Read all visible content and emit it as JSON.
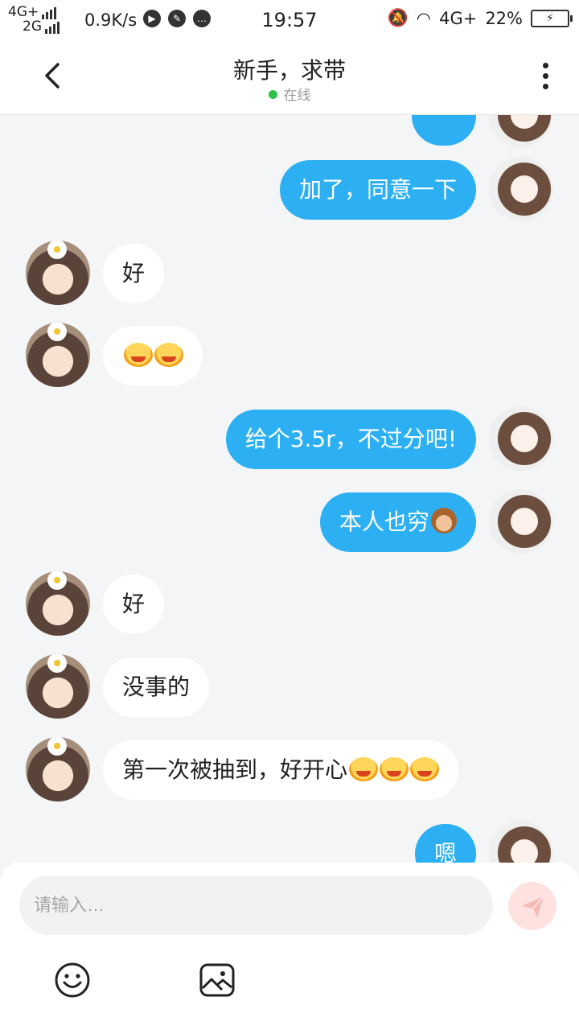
{
  "status_bar": {
    "net1": "4G+",
    "net2": "2G",
    "speed": "0.9K/s",
    "time": "19:57",
    "net3": "4G+",
    "battery": "22%"
  },
  "header": {
    "title": "新手，求带",
    "presence": "在线",
    "online_color": "#2bc24a"
  },
  "messages": [
    {
      "from": "me",
      "text": "加了，同意一下"
    },
    {
      "from": "other",
      "text": "好"
    },
    {
      "from": "other",
      "text": "",
      "emojis": [
        "laughing-emoji",
        "laughing-emoji"
      ]
    },
    {
      "from": "me",
      "text": "给个3.5r，不过分吧!"
    },
    {
      "from": "me",
      "text": "本人也穷",
      "emojis": [
        "monkey-emoji"
      ]
    },
    {
      "from": "other",
      "text": "好"
    },
    {
      "from": "other",
      "text": "没事的"
    },
    {
      "from": "other",
      "text": "第一次被抽到，好开心",
      "emojis": [
        "laughing-emoji",
        "laughing-emoji",
        "laughing-emoji"
      ]
    },
    {
      "from": "me",
      "text": "嗯"
    }
  ],
  "input": {
    "placeholder": "请输入…"
  },
  "colors": {
    "my_bubble": "#2db0f3",
    "other_bubble": "#ffffff",
    "send_button": "#fde2e0"
  },
  "icons": {
    "back": "chevron-left-icon",
    "more": "more-vertical-icon",
    "send": "send-icon",
    "emoji": "smiley-icon",
    "image": "image-icon"
  }
}
